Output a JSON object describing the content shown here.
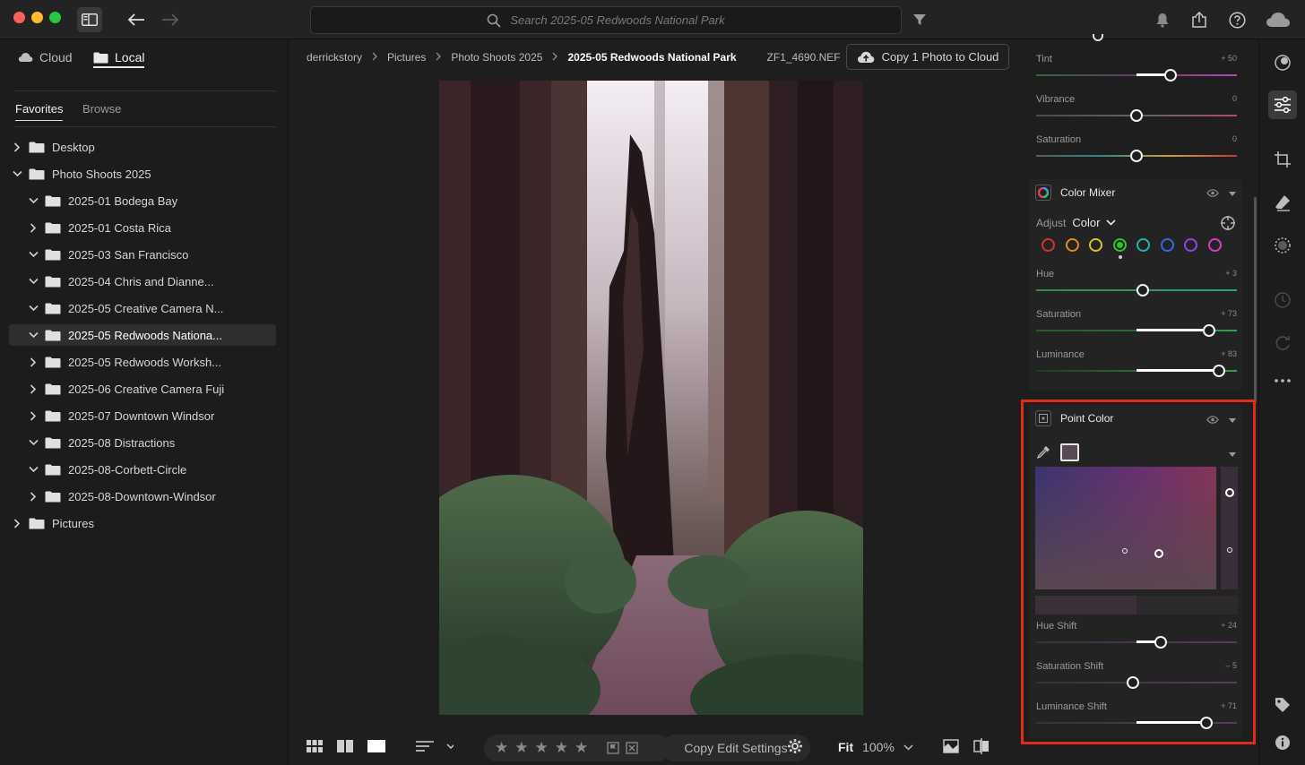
{
  "topbar": {
    "search_placeholder": "Search 2025-05 Redwoods National Park"
  },
  "left_panel": {
    "location_tabs": {
      "cloud": "Cloud",
      "local": "Local"
    },
    "sub_tabs": {
      "favorites": "Favorites",
      "browse": "Browse"
    },
    "tree": [
      {
        "label": "Desktop",
        "level": 0,
        "expanded": false,
        "selected": false
      },
      {
        "label": "Photo Shoots 2025",
        "level": 0,
        "expanded": true,
        "selected": false
      },
      {
        "label": "2025-01 Bodega Bay",
        "level": 1,
        "expanded": true,
        "selected": false
      },
      {
        "label": "2025-01 Costa Rica",
        "level": 1,
        "expanded": false,
        "selected": false
      },
      {
        "label": "2025-03 San Francisco",
        "level": 1,
        "expanded": true,
        "selected": false
      },
      {
        "label": "2025-04 Chris and Dianne...",
        "level": 1,
        "expanded": true,
        "selected": false
      },
      {
        "label": "2025-05 Creative Camera N...",
        "level": 1,
        "expanded": true,
        "selected": false
      },
      {
        "label": "2025-05 Redwoods Nationa...",
        "level": 1,
        "expanded": true,
        "selected": true
      },
      {
        "label": "2025-05 Redwoods Worksh...",
        "level": 1,
        "expanded": false,
        "selected": false
      },
      {
        "label": "2025-06 Creative Camera Fuji",
        "level": 1,
        "expanded": false,
        "selected": false
      },
      {
        "label": "2025-07 Downtown Windsor",
        "level": 1,
        "expanded": false,
        "selected": false
      },
      {
        "label": "2025-08 Distractions",
        "level": 1,
        "expanded": true,
        "selected": false
      },
      {
        "label": "2025-08-Corbett-Circle",
        "level": 1,
        "expanded": true,
        "selected": false
      },
      {
        "label": "2025-08-Downtown-Windsor",
        "level": 1,
        "expanded": false,
        "selected": false
      },
      {
        "label": "Pictures",
        "level": 0,
        "expanded": false,
        "selected": false
      }
    ]
  },
  "breadcrumb": [
    "derrickstory",
    "Pictures",
    "Photo Shoots 2025",
    "2025-05 Redwoods National Park",
    "ZF1_4690.NEF"
  ],
  "copy_to_cloud_label": "Copy 1 Photo to Cloud",
  "bottombar": {
    "copy_edit_label": "Copy Edit Settings",
    "fit_label": "Fit",
    "zoom": "100%",
    "rating": 0
  },
  "edit_panel": {
    "color_sliders": [
      {
        "name": "Tint",
        "value": "+ 50",
        "pos": 0.67
      },
      {
        "name": "Vibrance",
        "value": "0",
        "pos": 0.5
      },
      {
        "name": "Saturation",
        "value": "0",
        "pos": 0.5
      }
    ],
    "color_mixer": {
      "title": "Color Mixer",
      "adjust_label": "Adjust",
      "adjust_value": "Color",
      "swatches": [
        "#d93030",
        "#e08a22",
        "#d9c42a",
        "#2ec02e",
        "#23b3b3",
        "#3a66e8",
        "#8a48e0",
        "#d040c8"
      ],
      "selected_swatch": 3,
      "sliders": [
        {
          "name": "Hue",
          "value": "+ 3",
          "pos": 0.53
        },
        {
          "name": "Saturation",
          "value": "+ 73",
          "pos": 0.86
        },
        {
          "name": "Luminance",
          "value": "+ 83",
          "pos": 0.91
        }
      ]
    },
    "point_color": {
      "title": "Point Color",
      "sliders": [
        {
          "name": "Hue Shift",
          "value": "+ 24",
          "pos": 0.62
        },
        {
          "name": "Saturation Shift",
          "value": "– 5",
          "pos": 0.48
        },
        {
          "name": "Luminance Shift",
          "value": "+ 71",
          "pos": 0.85
        }
      ]
    }
  },
  "icons": {
    "search": "magnifier-icon",
    "filter": "funnel-icon",
    "notifications": "bell-icon",
    "share": "share-icon",
    "help": "help-icon",
    "cloud_status": "cloud-icon"
  },
  "colors": {
    "highlight_border": "#e32b1a",
    "slider_knob": "#f2f2f2"
  }
}
